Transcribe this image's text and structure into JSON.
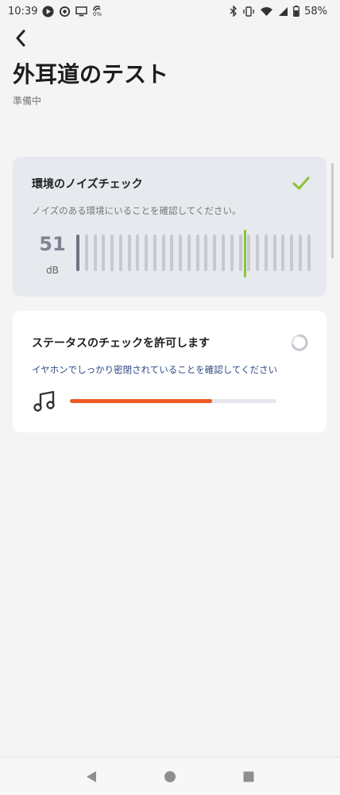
{
  "status_bar": {
    "time": "10:39",
    "battery": "58%",
    "indicator_percent": "0%",
    "icons_left": [
      "play-icon",
      "sync-icon",
      "cast-icon",
      "fan-icon"
    ],
    "icons_right": [
      "bluetooth-icon",
      "vibrate-icon",
      "wifi-icon",
      "signal-icon",
      "battery-icon"
    ]
  },
  "header": {
    "title": "外耳道のテスト",
    "subtitle": "準備中"
  },
  "noise_check": {
    "title": "環境のノイズチェック",
    "description": "ノイズのある環境にいることを確認してください。",
    "value": "51",
    "unit": "dB",
    "status": "done",
    "meter_bars": 28,
    "meter_active_bars": 1,
    "meter_level_fraction": 0.72,
    "colors": {
      "needle": "#8cc43c",
      "check": "#8cc43c"
    }
  },
  "status_check": {
    "title": "ステータスのチェックを許可します",
    "description": "イヤホンでしっかり密閉されていることを確認してください",
    "status": "loading",
    "progress_fraction": 0.69,
    "colors": {
      "progress": "#ee5a24"
    }
  },
  "nav_bar": {
    "buttons": [
      "back-triangle-icon",
      "home-circle-icon",
      "recents-square-icon"
    ]
  }
}
